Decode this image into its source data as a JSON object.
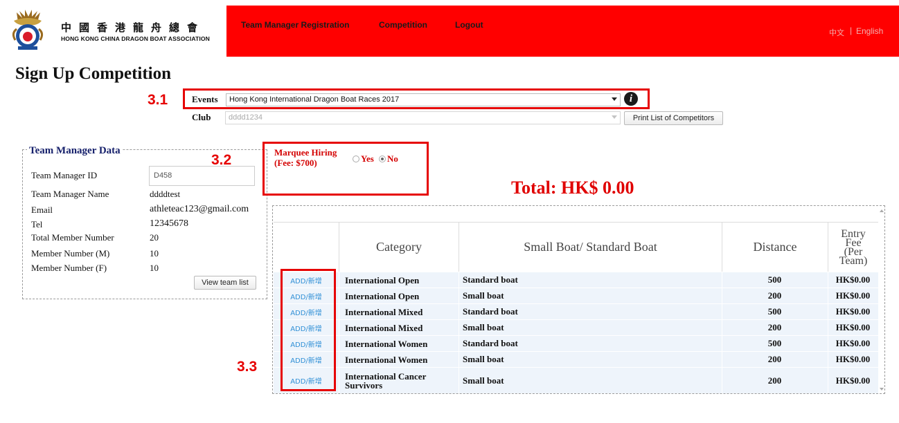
{
  "header": {
    "logo_cn": "中國香港龍舟總會",
    "logo_en": "HONG KONG CHINA DRAGON BOAT ASSOCIATION",
    "nav": [
      "Team Manager Registration",
      "Competition",
      "Logout"
    ],
    "lang_cn": "中文",
    "lang_sep": "|",
    "lang_en": "English",
    "brand_color": "#ff0000"
  },
  "page_title": "Sign Up Competition",
  "annotations": {
    "a1": "3.1",
    "a2": "3.2",
    "a3": "3.3"
  },
  "events": {
    "label": "Events",
    "selected": "Hong Kong International Dragon Boat Races 2017",
    "info_icon": "i"
  },
  "club": {
    "label": "Club",
    "value": "dddd1234",
    "print_button": "Print List of Competitors"
  },
  "team_manager": {
    "legend": "Team Manager Data",
    "id_label": "Team Manager ID",
    "id_value": "D458",
    "fields": [
      {
        "label": "Team Manager Name",
        "value": "ddddtest"
      },
      {
        "label": "Email",
        "value": "athleteac123@gmail.com"
      },
      {
        "label": "Tel",
        "value": "12345678"
      },
      {
        "label": "Total Member Number",
        "value": "20"
      },
      {
        "label": "Member Number (M)",
        "value": "10"
      },
      {
        "label": "Member Number (F)",
        "value": "10"
      }
    ],
    "view_button": "View team list"
  },
  "marquee": {
    "label_line1": "Marquee Hiring",
    "label_line2": "(Fee: $700)",
    "yes": "Yes",
    "no": "No",
    "selected": "No"
  },
  "total": "Total: HK$ 0.00",
  "table": {
    "headers": {
      "category": "Category",
      "boat": "Small Boat/ Standard Boat",
      "distance": "Distance",
      "fee_l1": "Entry",
      "fee_l2": "Fee",
      "fee_l3": "(Per",
      "fee_l4": "Team)"
    },
    "rows": [
      {
        "add": "ADD/新增",
        "category": "International Open",
        "category_l2": "",
        "boat": "Standard boat",
        "distance": "500",
        "fee": "HK$0.00"
      },
      {
        "add": "ADD/新增",
        "category": "International Open",
        "category_l2": "",
        "boat": "Small boat",
        "distance": "200",
        "fee": "HK$0.00"
      },
      {
        "add": "ADD/新增",
        "category": "International Mixed",
        "category_l2": "",
        "boat": "Standard boat",
        "distance": "500",
        "fee": "HK$0.00"
      },
      {
        "add": "ADD/新增",
        "category": "International Mixed",
        "category_l2": "",
        "boat": "Small boat",
        "distance": "200",
        "fee": "HK$0.00"
      },
      {
        "add": "ADD/新增",
        "category": "International Women",
        "category_l2": "",
        "boat": "Standard boat",
        "distance": "500",
        "fee": "HK$0.00"
      },
      {
        "add": "ADD/新增",
        "category": "International Women",
        "category_l2": "",
        "boat": "Small boat",
        "distance": "200",
        "fee": "HK$0.00"
      },
      {
        "add": "ADD/新增",
        "category": "International Cancer",
        "category_l2": "Survivors",
        "boat": "Small boat",
        "distance": "200",
        "fee": "HK$0.00"
      }
    ]
  }
}
